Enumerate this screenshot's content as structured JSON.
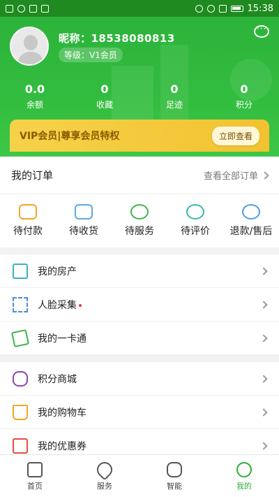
{
  "status_bar": {
    "time": "15:38"
  },
  "profile": {
    "nickname": "昵称：18538080813",
    "level": "等级：V1会员"
  },
  "stats": [
    {
      "value": "0.0",
      "label": "余额"
    },
    {
      "value": "0",
      "label": "收藏"
    },
    {
      "value": "0",
      "label": "足迹"
    },
    {
      "value": "0",
      "label": "积分"
    }
  ],
  "vip": {
    "text": "VIP会员|尊享会员特权",
    "button": "立即查看"
  },
  "orders": {
    "title": "我的订单",
    "view_all": "查看全部订单",
    "items": [
      {
        "label": "待付款",
        "icon": "wallet-icon",
        "color": "#f0a72b"
      },
      {
        "label": "待收货",
        "icon": "truck-icon",
        "color": "#5aa9e6"
      },
      {
        "label": "待服务",
        "icon": "service-icon",
        "color": "#3bb54a"
      },
      {
        "label": "待评价",
        "icon": "review-icon",
        "color": "#35b8b0"
      },
      {
        "label": "退款/售后",
        "icon": "refund-icon",
        "color": "#4a9de0"
      }
    ]
  },
  "menu_group1": [
    {
      "label": "我的房产",
      "icon": "house-icon",
      "color": "#3bb1c7"
    },
    {
      "label": "人脸采集",
      "icon": "face-scan-icon",
      "color": "#4a8ee0",
      "dot": true
    },
    {
      "label": "我的一卡通",
      "icon": "card-icon",
      "color": "#3bb54a"
    }
  ],
  "menu_group2": [
    {
      "label": "积分商城",
      "icon": "database-icon",
      "color": "#8e44ad"
    },
    {
      "label": "我的购物车",
      "icon": "cart-icon",
      "color": "#f0a72b"
    },
    {
      "label": "我的优惠券",
      "icon": "coupon-icon",
      "color": "#e74c3c"
    }
  ],
  "nav": [
    {
      "label": "首页",
      "icon": "home-icon"
    },
    {
      "label": "服务",
      "icon": "heart-icon"
    },
    {
      "label": "智能",
      "icon": "robot-icon"
    },
    {
      "label": "我的",
      "icon": "profile-icon",
      "active": true
    }
  ],
  "colors": {
    "primary": "#2cb33a",
    "vip": "#f2c230"
  }
}
